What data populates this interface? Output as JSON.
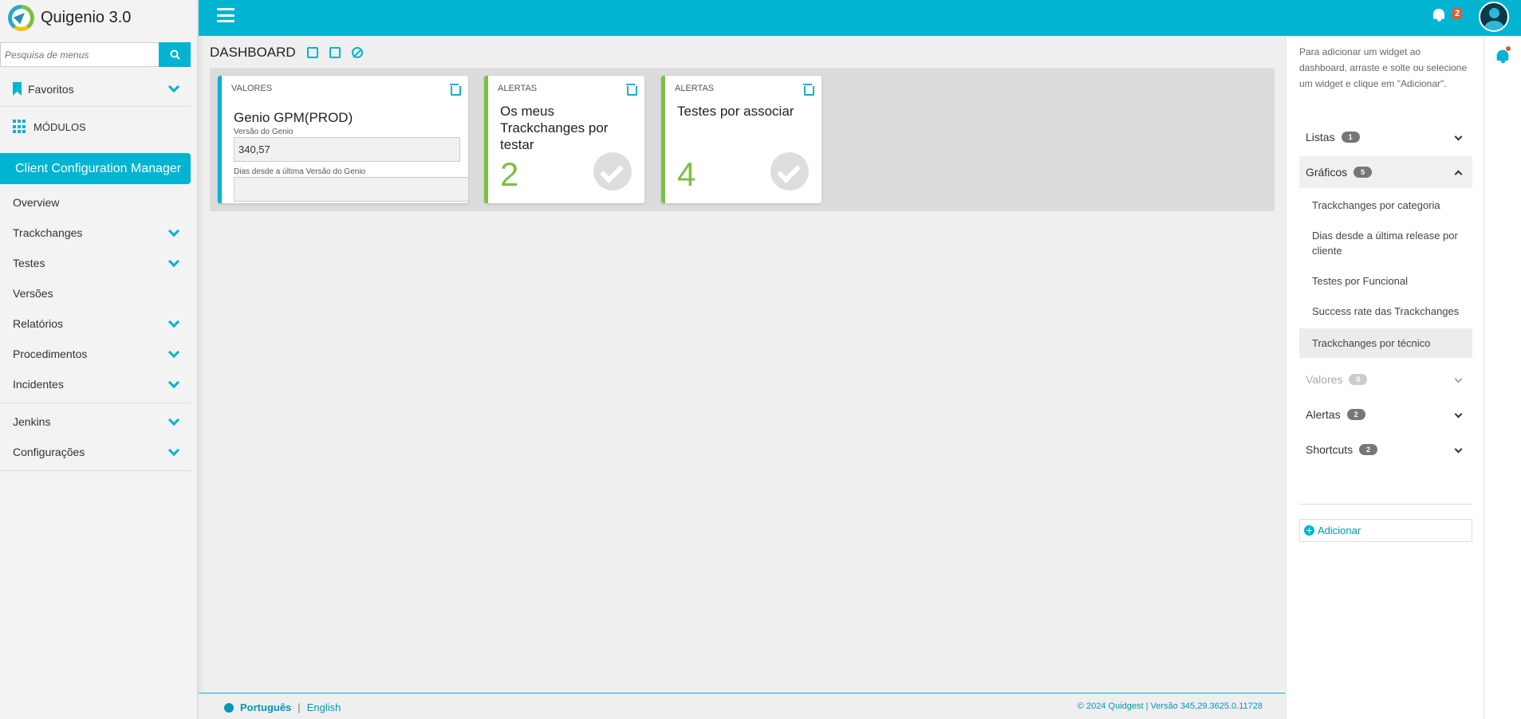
{
  "app": {
    "title": "Quigenio 3.0"
  },
  "search": {
    "placeholder": "Pesquisa de menus"
  },
  "sidebar": {
    "favorites": "Favoritos",
    "modules": "MÓDULOS",
    "active_module": "Client Configuration Manager",
    "items": [
      {
        "label": "Overview",
        "expandable": false
      },
      {
        "label": "Trackchanges",
        "expandable": true
      },
      {
        "label": "Testes",
        "expandable": true
      },
      {
        "label": "Versões",
        "expandable": false
      },
      {
        "label": "Relatórios",
        "expandable": true
      },
      {
        "label": "Procedimentos",
        "expandable": true
      },
      {
        "label": "Incidentes",
        "expandable": true
      }
    ],
    "items2": [
      {
        "label": "Jenkins",
        "expandable": true
      },
      {
        "label": "Configurações",
        "expandable": true
      }
    ]
  },
  "topbar": {
    "notifications_count": "2"
  },
  "dashboard": {
    "title": "DASHBOARD",
    "cards": [
      {
        "type": "VALORES",
        "title": "Genio GPM(PROD)",
        "field1_label": "Versão do Genio",
        "field1_value": "340,57",
        "field2_label": "Dias desde a última Versão do Genio",
        "field2_value": "",
        "accent": "#00b4d2"
      },
      {
        "type": "ALERTAS",
        "title": "Os meus Trackchanges por testar",
        "value": "2",
        "accent": "#7cbf42"
      },
      {
        "type": "ALERTAS",
        "title": "Testes por associar",
        "value": "4",
        "accent": "#7cbf42"
      }
    ]
  },
  "right_panel": {
    "hint": "Para adicionar um widget ao dashboard, arraste e solte ou selecione um widget e clique em \"Adicionar\".",
    "sections": [
      {
        "label": "Listas",
        "count": "1"
      },
      {
        "label": "Gráficos",
        "count": "5"
      },
      {
        "label": "Valores",
        "count": "0"
      },
      {
        "label": "Alertas",
        "count": "2"
      },
      {
        "label": "Shortcuts",
        "count": "2"
      }
    ],
    "graficos_items": [
      "Trackchanges por categoria",
      "Dias desde a última release por cliente",
      "Testes por Funcional",
      "Success rate das Trackchanges",
      "Trackchanges por técnico"
    ],
    "add_label": "Adicionar"
  },
  "footer": {
    "lang_pt": "Português",
    "separator": "|",
    "lang_en": "English",
    "copyright": "© 2024 Quidgest | Versão 345,29.3625.0.11728"
  },
  "colors": {
    "accent": "#00b4d2",
    "green": "#7cbf42",
    "badge_orange": "#e8582a"
  }
}
